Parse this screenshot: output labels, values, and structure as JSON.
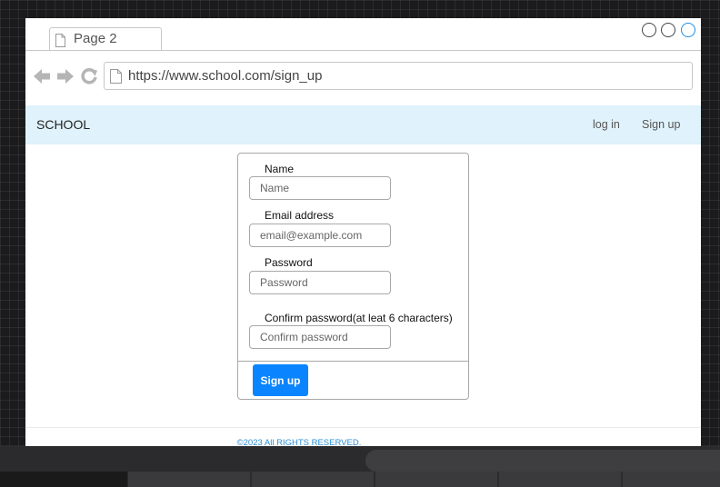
{
  "browser": {
    "tab_title": "Page 2",
    "url": "https://www.school.com/sign_up"
  },
  "site": {
    "brand": "SCHOOL",
    "nav": {
      "login_label": "log in",
      "signup_label": "Sign up"
    }
  },
  "form": {
    "fields": [
      {
        "label": "Name",
        "placeholder": "Name"
      },
      {
        "label": "Email address",
        "placeholder": "email@example.com"
      },
      {
        "label": "Password",
        "placeholder": "Password"
      },
      {
        "label": "Confirm password(at leat 6 characters)",
        "placeholder": "Confirm password"
      }
    ],
    "submit_label": "Sign up"
  },
  "footer": {
    "text": "©2023 All RIGHTS RESERVED."
  },
  "colors": {
    "primary_button": "#0a84ff",
    "navbar_bg": "#e0f2fb",
    "footer_link": "#2b8ed6",
    "canvas_bg": "#1b1b1d"
  },
  "icons": [
    "page-icon",
    "back-arrow-icon",
    "forward-arrow-icon",
    "refresh-icon",
    "window-circle-icon"
  ]
}
